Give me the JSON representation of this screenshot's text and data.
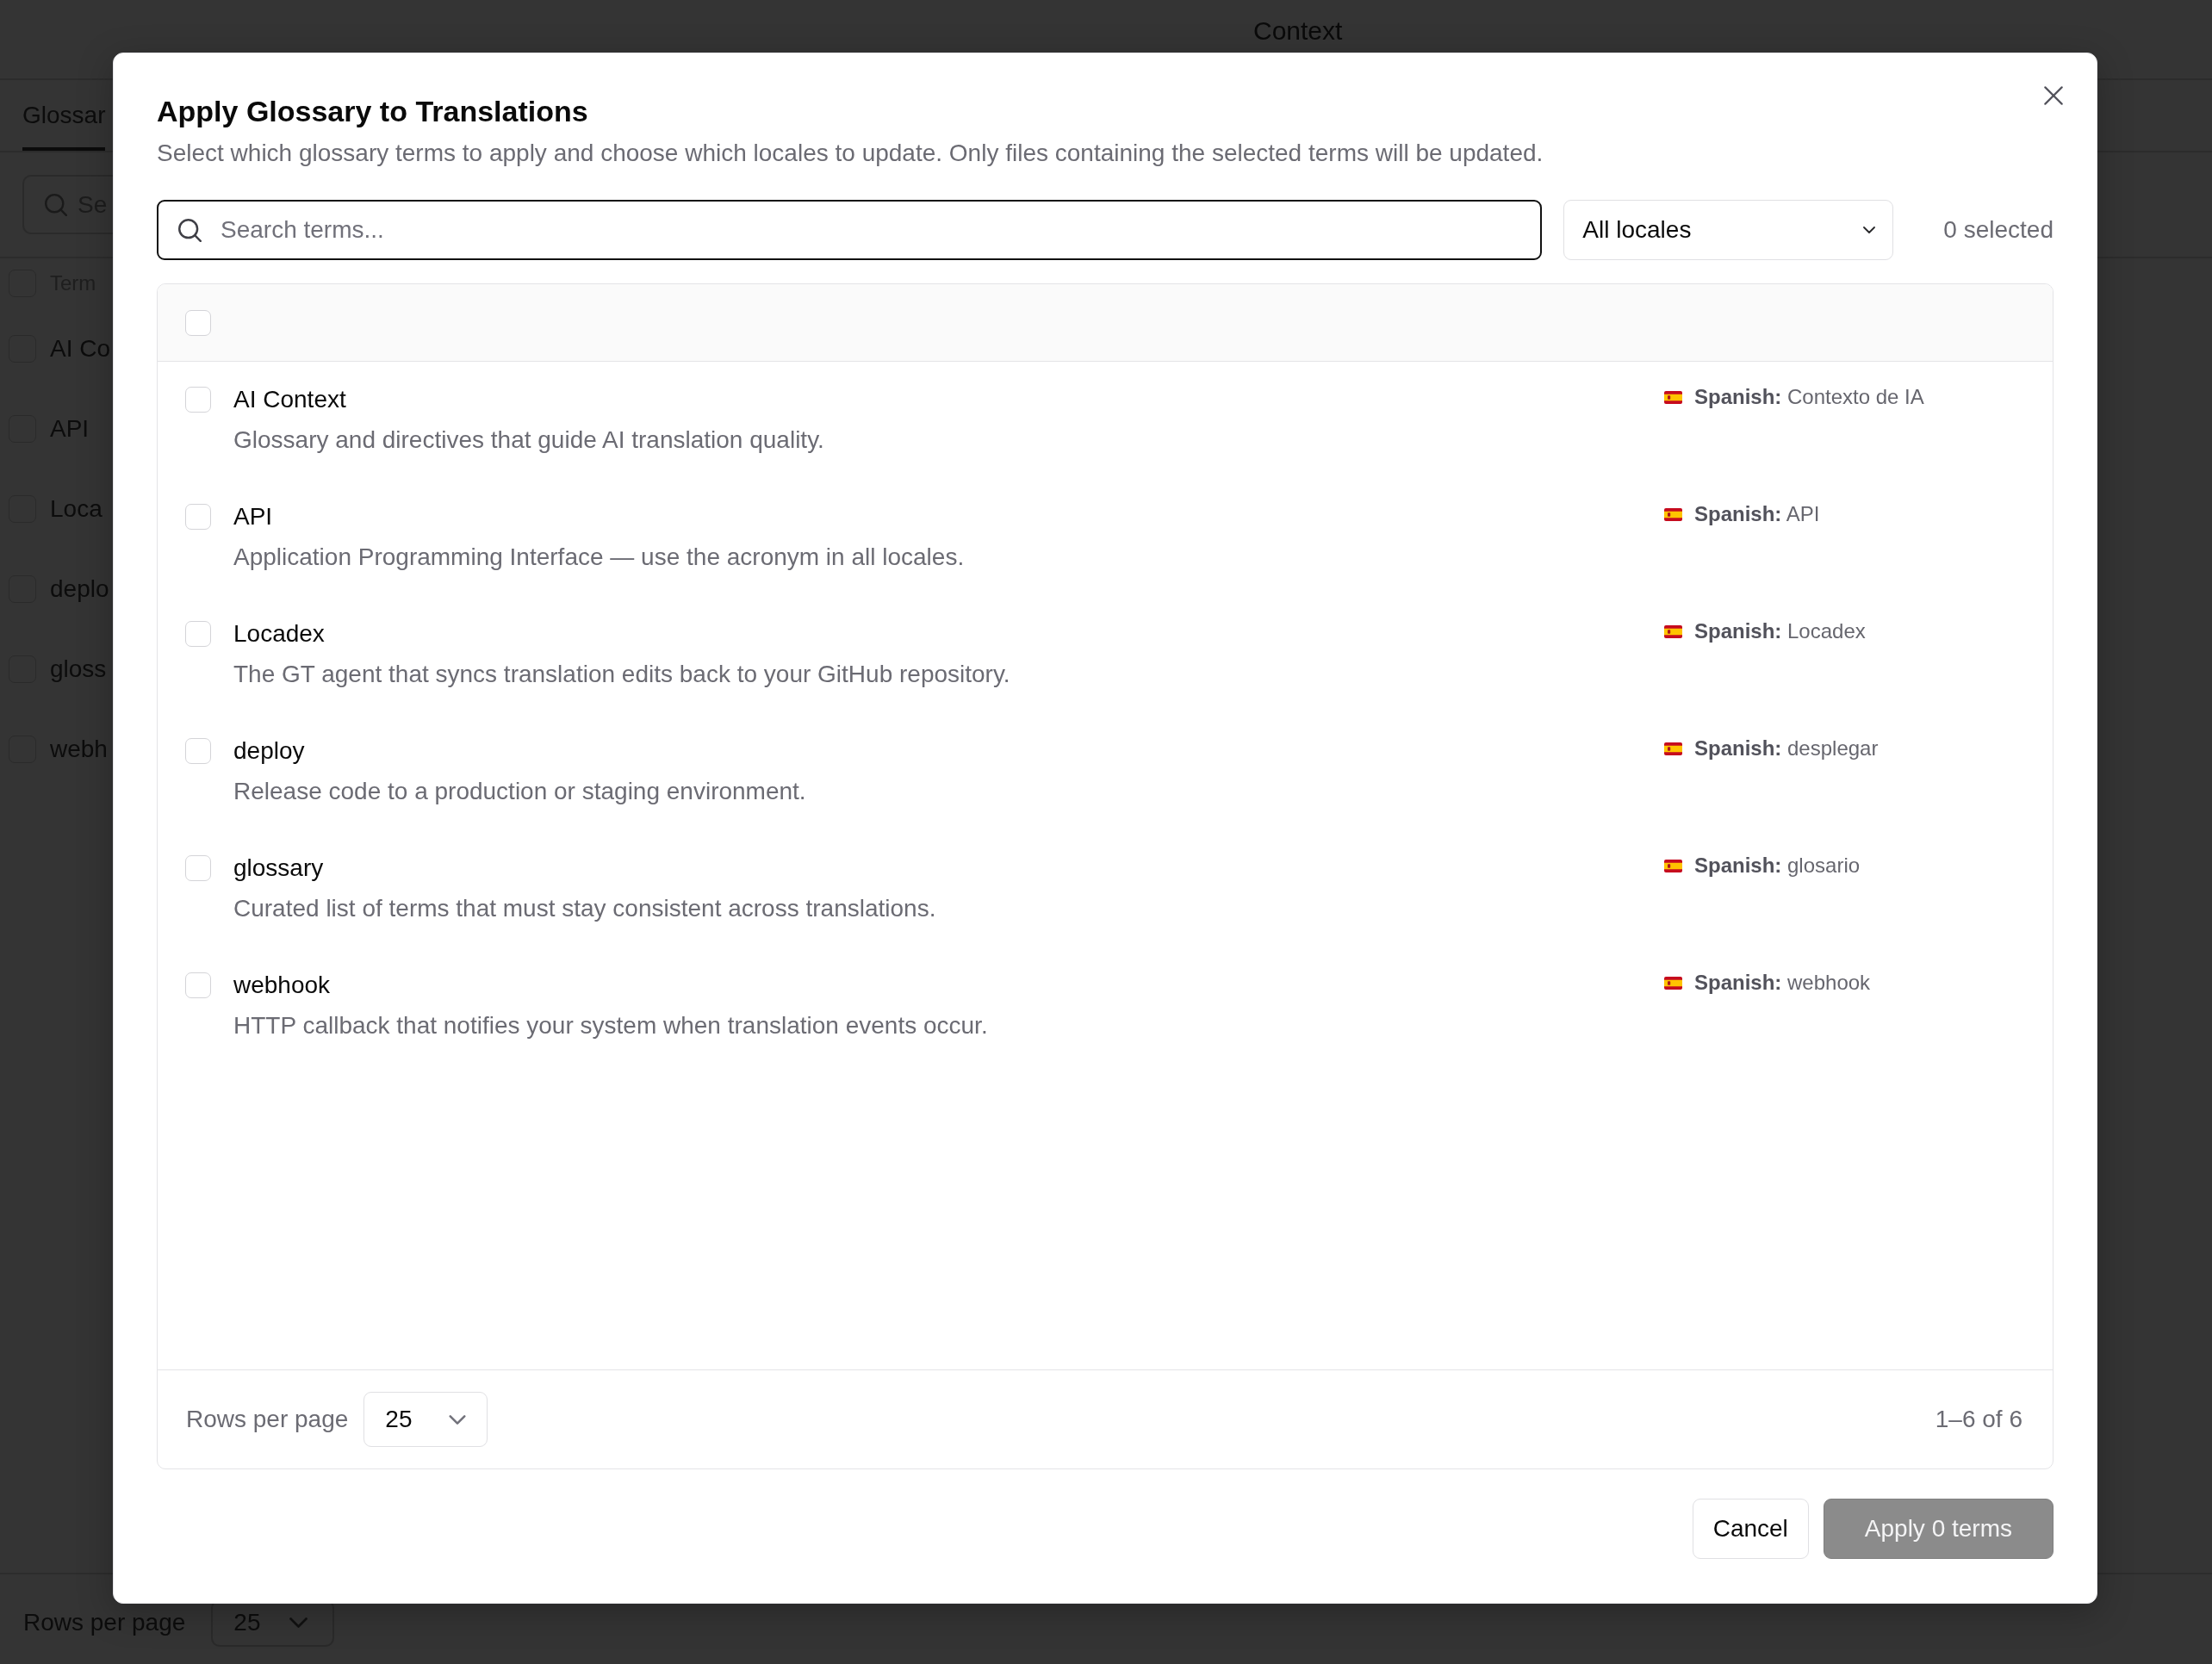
{
  "page": {
    "header_title": "Context",
    "tabs": [
      {
        "label": "Glossar",
        "selected": true
      }
    ],
    "search": {
      "placeholder": "Se"
    },
    "table": {
      "columns": [
        "Term"
      ],
      "header_checkbox": {
        "checked": false
      },
      "rows": [
        {
          "term": "AI Co",
          "checked": false
        },
        {
          "term": "API",
          "checked": false
        },
        {
          "term": "Loca",
          "checked": false
        },
        {
          "term": "deplo",
          "checked": false
        },
        {
          "term": "gloss",
          "checked": false
        },
        {
          "term": "webh",
          "checked": false
        }
      ]
    },
    "footer": {
      "rows_per_page_label": "Rows per page",
      "rows_per_page": "25"
    }
  },
  "dialog": {
    "title": "Apply Glossary to Translations",
    "description": "Select which glossary terms to apply and choose which locales to update. Only files containing the selected terms will be updated.",
    "search": {
      "placeholder": "Search terms..."
    },
    "locale_select": {
      "value": "All locales"
    },
    "selection_count": "0 selected",
    "select_all": {
      "checked": false
    },
    "terms": [
      {
        "term": "AI Context",
        "description": "Glossary and directives that guide AI translation quality.",
        "translation": "**Spanish:** Contexto de IA",
        "checked": false
      },
      {
        "term": "API",
        "description": "Application Programming Interface — use the acronym in all locales.",
        "translation": "**Spanish:** API",
        "checked": false
      },
      {
        "term": "Locadex",
        "description": "The GT agent that syncs translation edits back to your GitHub repository.",
        "translation": "**Spanish:** Locadex",
        "checked": false
      },
      {
        "term": "deploy",
        "description": "Release code to a production or staging environment.",
        "translation": "**Spanish:** desplegar",
        "checked": false
      },
      {
        "term": "glossary",
        "description": "Curated list of terms that must stay consistent across translations.",
        "translation": "**Spanish:** glosario",
        "checked": false
      },
      {
        "term": "webhook",
        "description": "HTTP callback that notifies your system when translation events occur.",
        "translation": "**Spanish:** webhook",
        "checked": false
      }
    ],
    "pagination": {
      "rows_per_page_label": "Rows per page",
      "rows_per_page": "25",
      "range": "1–6 of 6"
    },
    "buttons": [
      {
        "label": "Cancel",
        "kind": "secondary",
        "disabled": false
      },
      {
        "label": "Apply 0 terms",
        "kind": "primary",
        "disabled": true
      }
    ]
  }
}
